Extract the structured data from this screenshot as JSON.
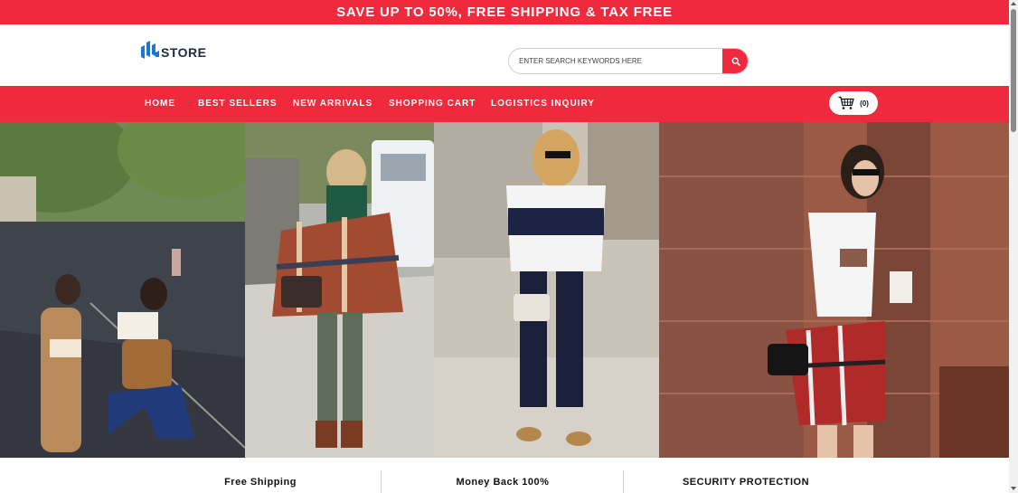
{
  "promo": {
    "text": "SAVE UP TO 50%, FREE SHIPPING & TAX FREE"
  },
  "header": {
    "logo_text": "STORE",
    "search": {
      "placeholder": "ENTER SEARCH KEYWORDS HERE",
      "value": ""
    }
  },
  "nav": {
    "items": [
      {
        "label": "HOME"
      },
      {
        "label": "BEST SELLERS"
      },
      {
        "label": "NEW ARRIVALS"
      },
      {
        "label": "SHOPPING CART"
      },
      {
        "label": "LOGISTICS INQUIRY"
      }
    ],
    "cart_count": "(0)"
  },
  "features": [
    {
      "label": "Free Shipping"
    },
    {
      "label": "Money Back 100%"
    },
    {
      "label": "SECURITY PROTECTION"
    }
  ],
  "icons": {
    "search": "search-icon",
    "cart": "shopping-cart-icon",
    "logo": "logo-icon"
  },
  "colors": {
    "accent": "#ee2a3c",
    "logo_blue": "#1976d2",
    "logo_text": "#1d2a44",
    "nav_text": "#ffffff"
  }
}
